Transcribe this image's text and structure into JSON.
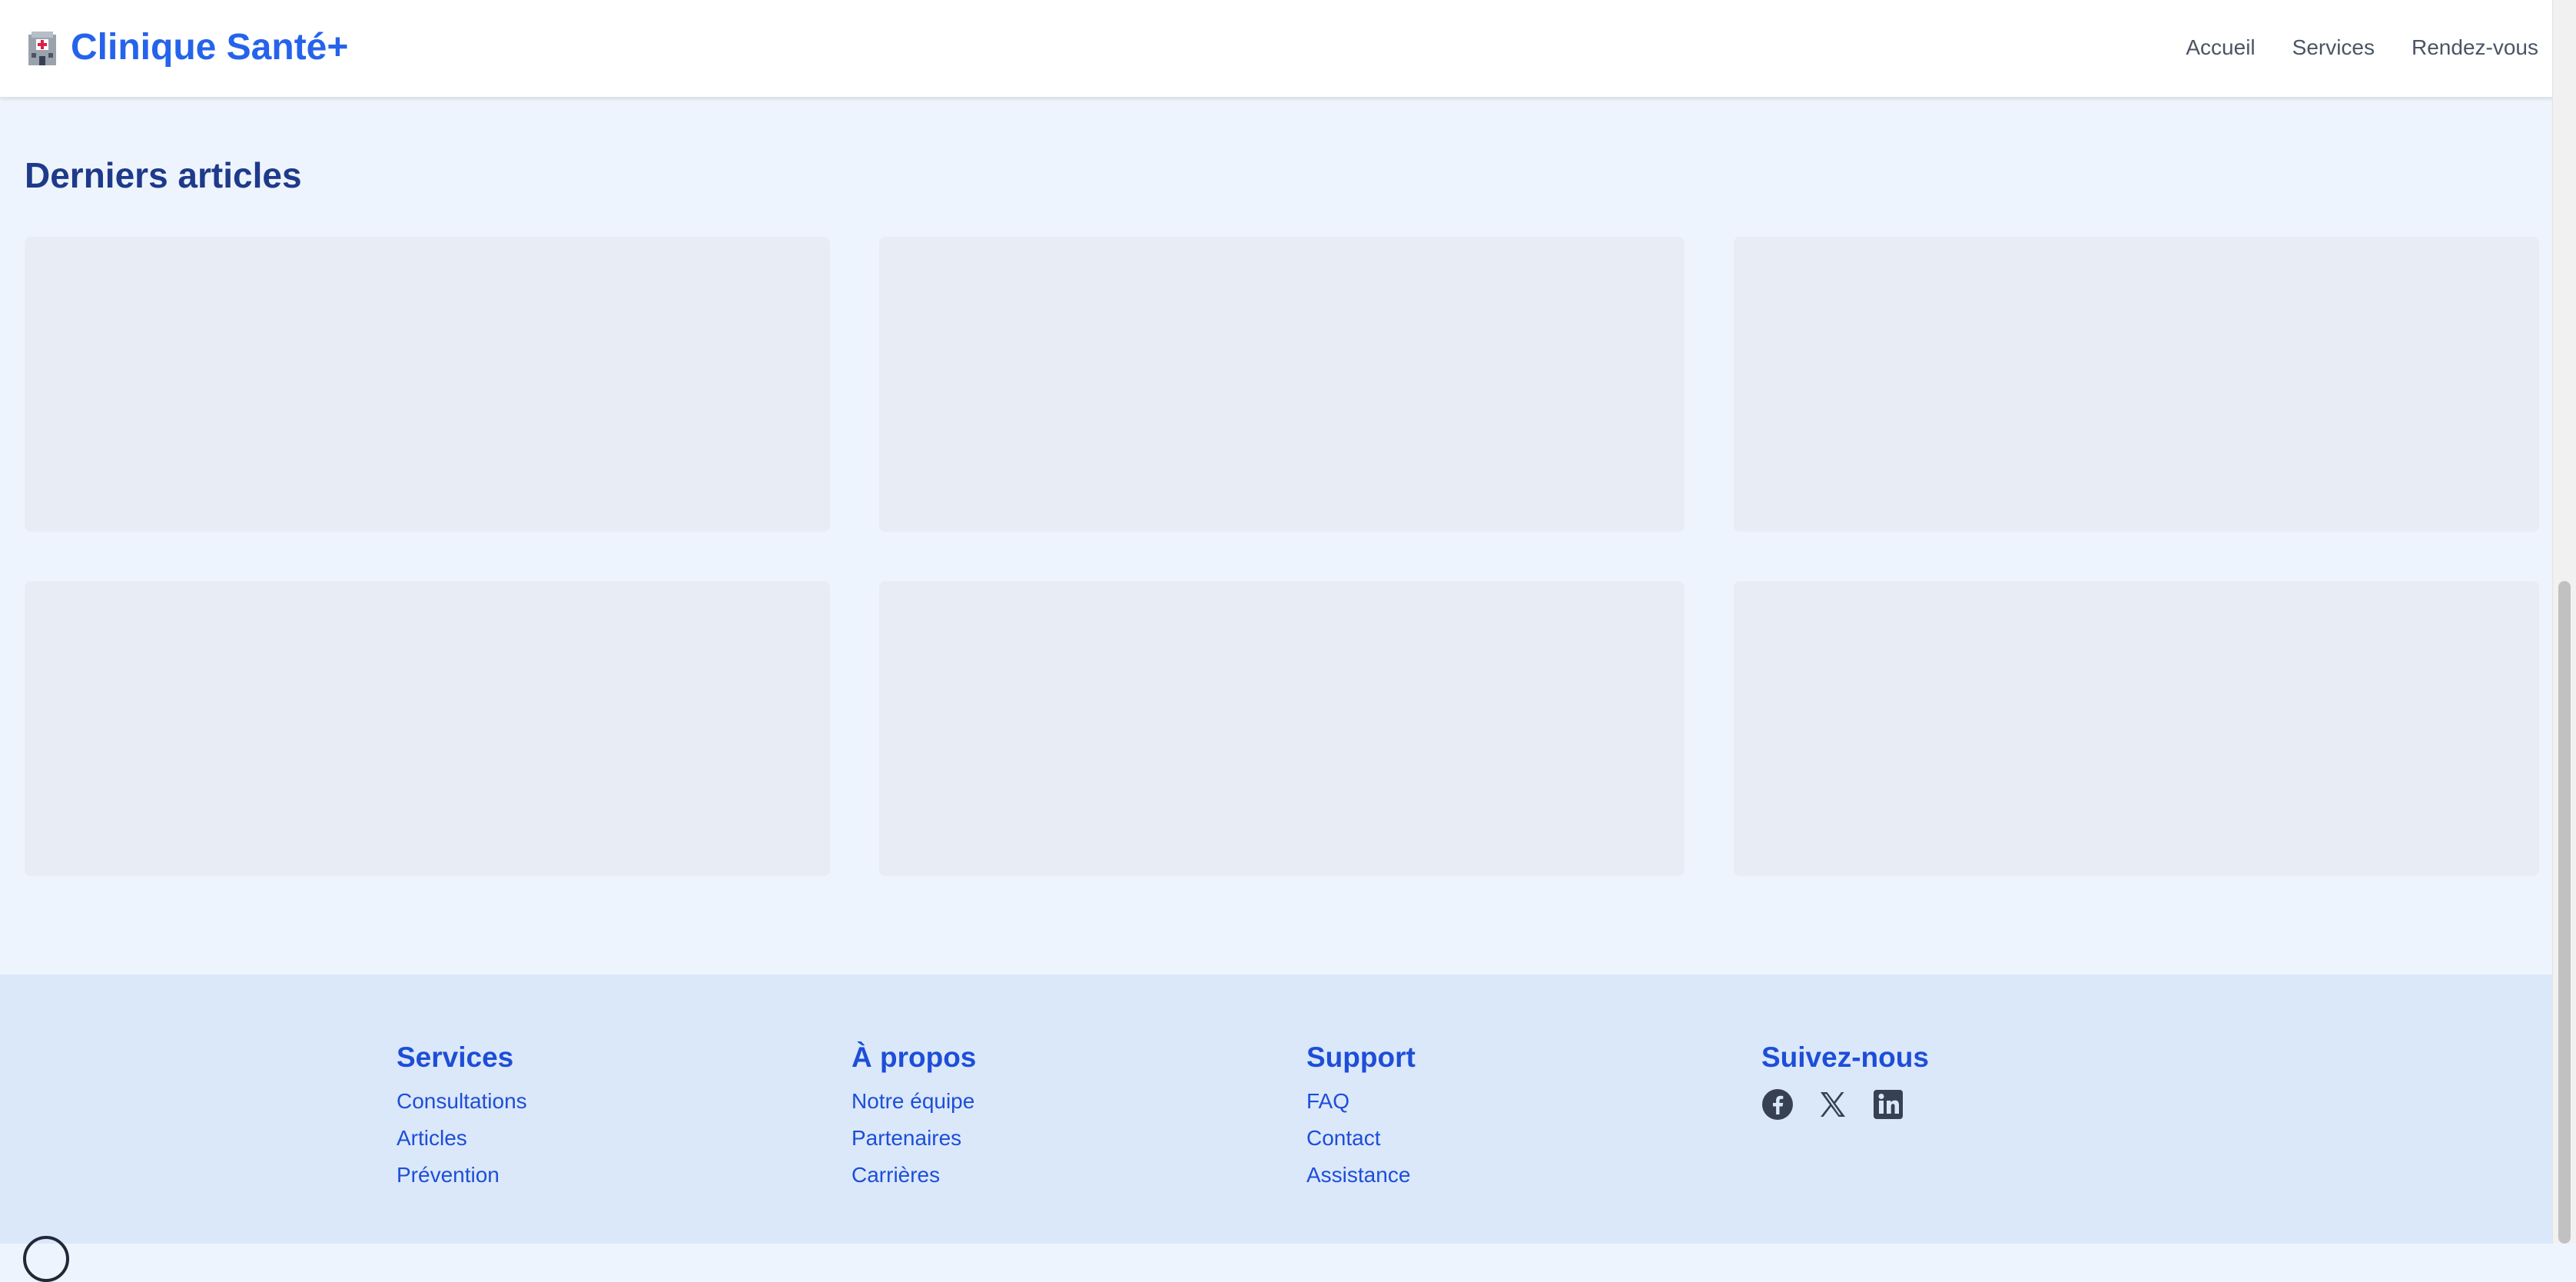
{
  "header": {
    "logo_icon": "hospital-icon",
    "brand": "Clinique Santé+",
    "nav": [
      "Accueil",
      "Services",
      "Rendez-vous"
    ]
  },
  "main": {
    "title": "Derniers articles",
    "articles": [
      {
        "state": "loading-placeholder"
      },
      {
        "state": "loading-placeholder"
      },
      {
        "state": "loading-placeholder"
      },
      {
        "state": "loading-placeholder"
      },
      {
        "state": "loading-placeholder"
      },
      {
        "state": "loading-placeholder"
      }
    ]
  },
  "footer": {
    "columns": [
      {
        "title": "Services",
        "links": [
          "Consultations",
          "Articles",
          "Prévention"
        ]
      },
      {
        "title": "À propos",
        "links": [
          "Notre équipe",
          "Partenaires",
          "Carrières"
        ]
      },
      {
        "title": "Support",
        "links": [
          "FAQ",
          "Contact",
          "Assistance"
        ]
      },
      {
        "title": "Suivez-nous",
        "links": []
      }
    ],
    "social_icons": [
      "facebook-icon",
      "x-twitter-icon",
      "linkedin-icon"
    ]
  },
  "colors": {
    "brand": "#2563eb",
    "page_background": "#eef4fd",
    "footer_background": "#dbe8fa",
    "heading": "#1e3a8a",
    "footer_link": "#1d4ed8",
    "card_placeholder": "#e8edf5"
  }
}
